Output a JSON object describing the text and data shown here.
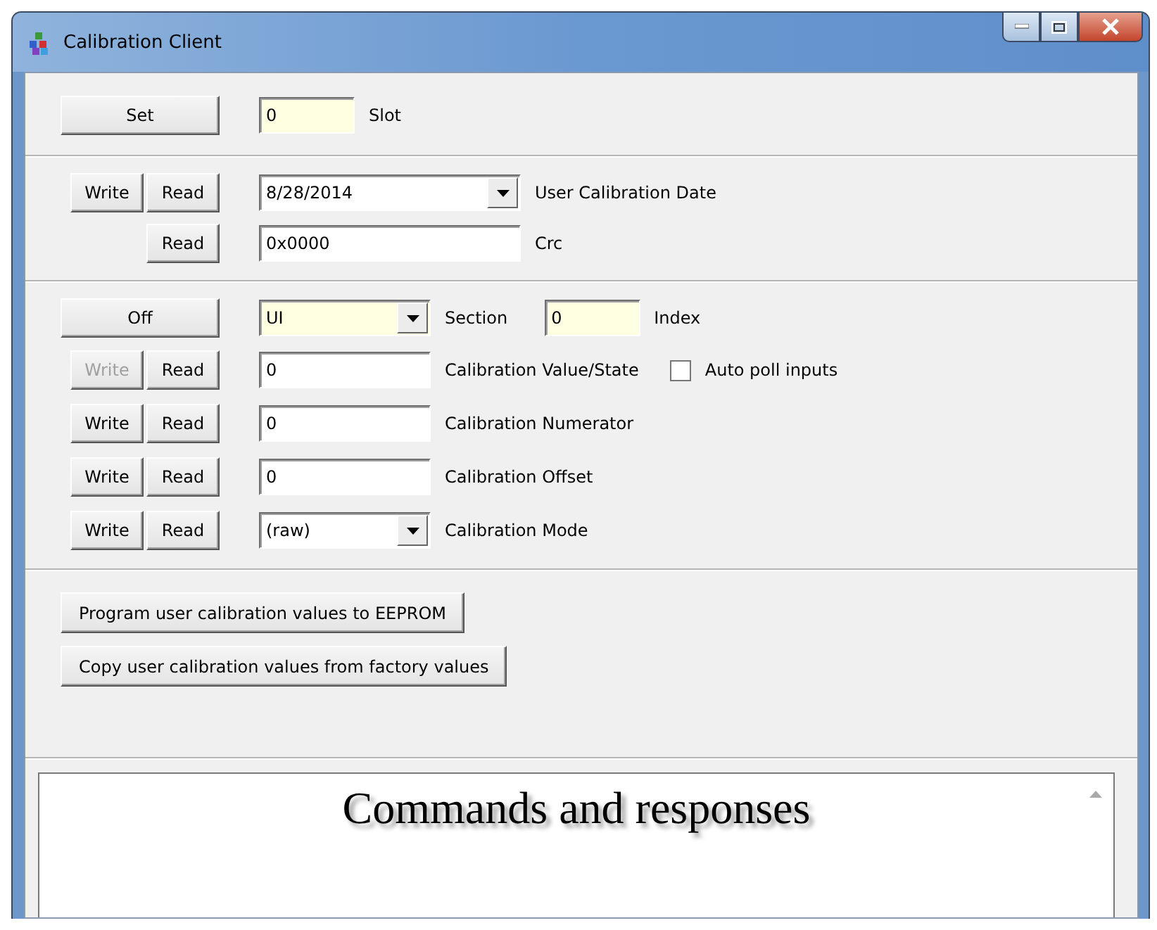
{
  "window": {
    "title": "Calibration Client"
  },
  "slot": {
    "button": "Set",
    "value": "0",
    "label": "Slot"
  },
  "date_group": [
    {
      "kind": "dropdown",
      "write": "Write",
      "read": "Read",
      "value": "8/28/2014",
      "label": "User Calibration Date"
    },
    {
      "kind": "field",
      "read": "Read",
      "value": "0x0000",
      "label": "Crc"
    }
  ],
  "section_row": {
    "button": "Off",
    "section_value": "UI",
    "section_label": "Section",
    "index_value": "0",
    "index_label": "Index"
  },
  "calibration_rows": [
    {
      "kind": "field",
      "write": "Write",
      "write_disabled": true,
      "read": "Read",
      "value": "0",
      "label": "Calibration Value/State",
      "checkbox": {
        "label": "Auto poll inputs",
        "checked": false
      }
    },
    {
      "kind": "field",
      "write": "Write",
      "write_disabled": false,
      "read": "Read",
      "value": "0",
      "label": "Calibration Numerator"
    },
    {
      "kind": "field",
      "write": "Write",
      "write_disabled": false,
      "read": "Read",
      "value": "0",
      "label": "Calibration Offset"
    },
    {
      "kind": "dropdown",
      "write": "Write",
      "write_disabled": false,
      "read": "Read",
      "value": "(raw)",
      "label": "Calibration Mode"
    }
  ],
  "actions": [
    "Program user calibration values to EEPROM",
    "Copy user calibration values from factory values"
  ],
  "log": {
    "text": "Commands and responses"
  }
}
